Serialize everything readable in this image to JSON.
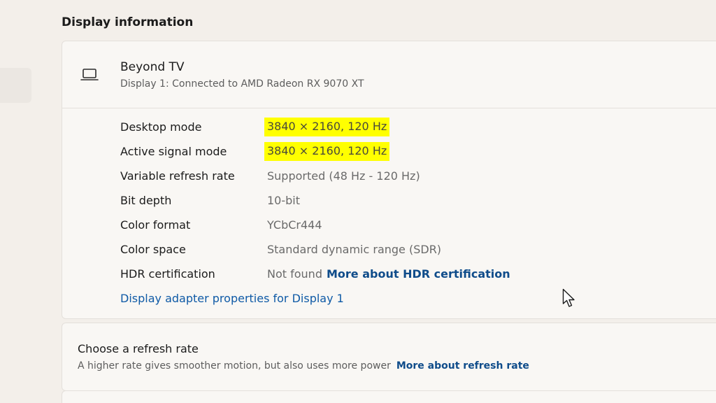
{
  "section": {
    "title": "Display information"
  },
  "display": {
    "icon": "laptop-monitor-icon",
    "name": "Beyond TV",
    "subtitle": "Display 1: Connected to AMD Radeon RX 9070 XT"
  },
  "details": [
    {
      "label": "Desktop mode",
      "value": "3840 × 2160, 120 Hz",
      "highlight_color": "#ffff00"
    },
    {
      "label": "Active signal mode",
      "value": "3840 × 2160, 120 Hz",
      "highlight_color": "#ffff00"
    },
    {
      "label": "Variable refresh rate",
      "value": "Supported (48 Hz - 120 Hz)"
    },
    {
      "label": "Bit depth",
      "value": "10-bit"
    },
    {
      "label": "Color format",
      "value": "YCbCr444"
    },
    {
      "label": "Color space",
      "value": "Standard dynamic range (SDR)"
    },
    {
      "label": "HDR certification",
      "value": "Not found",
      "link": "More about HDR certification"
    }
  ],
  "adapter_link": "Display adapter properties for Display 1",
  "refresh": {
    "title": "Choose a refresh rate",
    "subtitle": "A higher rate gives smoother motion, but also uses more power",
    "link": "More about refresh rate"
  },
  "colors": {
    "link": "#0f4c8a",
    "highlight": "#ffff00",
    "background": "#f3efea",
    "card": "#f9f7f4"
  },
  "cursor_icon": "mouse-pointer-icon"
}
